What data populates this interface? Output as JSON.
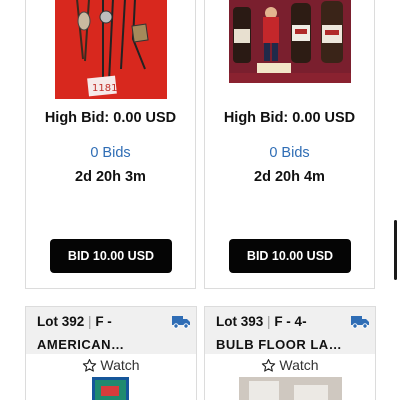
{
  "top_cards": [
    {
      "image_label": "lot photo: bolo ties on red background",
      "image_tag": "1181",
      "high_bid": "High Bid: 0.00 USD",
      "bids": "0 Bids",
      "time_left": "2d 20h 3m",
      "bid_button": "BID 10.00 USD"
    },
    {
      "image_label": "lot photo: vintage bottles and figurine",
      "image_tag": "",
      "high_bid": "High Bid: 0.00 USD",
      "bids": "0 Bids",
      "time_left": "2d 20h 4m",
      "bid_button": "BID 10.00 USD"
    }
  ],
  "bottom_cards": [
    {
      "lot_number": "Lot 392",
      "separator": "|",
      "title_line1": "F -",
      "title_line2": "AMERICAN…",
      "watch_label": "Watch",
      "shipping_icon": "truck-icon"
    },
    {
      "lot_number": "Lot 393",
      "separator": "|",
      "title_line1": "F - 4-",
      "title_line2": "BULB FLOOR LA…",
      "watch_label": "Watch",
      "shipping_icon": "truck-icon"
    }
  ],
  "colors": {
    "link_blue": "#2f6db5",
    "button_black": "#050505",
    "truck_blue": "#2f6db5"
  }
}
